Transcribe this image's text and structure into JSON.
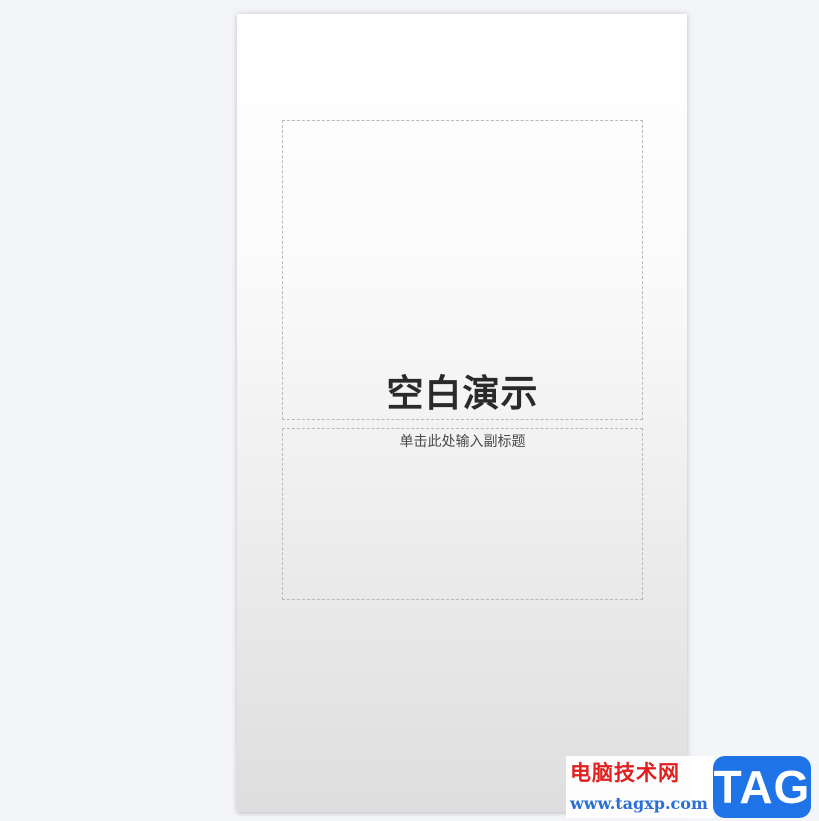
{
  "slide": {
    "title": "空白演示",
    "subtitle_placeholder": "单击此处输入副标题"
  },
  "watermark": {
    "site_name": "电脑技术网",
    "url": "www.tagxp.com",
    "badge": "TAG"
  },
  "colors": {
    "workspace_background": "#f4f5f8",
    "title_text": "#2a2a2a",
    "subtitle_text": "#4a4a4a",
    "watermark_red": "#e02020",
    "watermark_blue": "#1e74e6"
  }
}
